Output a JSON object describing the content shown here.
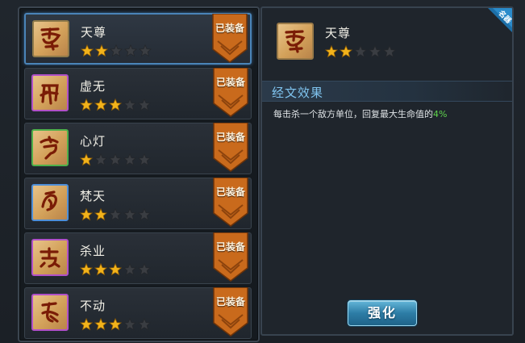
{
  "colors": {
    "star_gold": "#f2b31b",
    "star_empty": "#3a3d42",
    "badge_orange": "#c96a1c",
    "accent_blue": "#4a84b8",
    "highlight_green": "#5fd44d"
  },
  "list": {
    "items": [
      {
        "name": "天尊",
        "stars_filled": 2,
        "stars_total": 5,
        "badge": "已装备",
        "frame_color": "#8f7a4a",
        "icon": "rune-glyph-icon",
        "selected": true
      },
      {
        "name": "虚无",
        "stars_filled": 3,
        "stars_total": 5,
        "badge": "已装备",
        "frame_color": "#b050c8",
        "icon": "rune-glyph-icon",
        "selected": false
      },
      {
        "name": "心灯",
        "stars_filled": 1,
        "stars_total": 5,
        "badge": "已装备",
        "frame_color": "#4fb04a",
        "icon": "rune-glyph-icon",
        "selected": false
      },
      {
        "name": "梵天",
        "stars_filled": 2,
        "stars_total": 5,
        "badge": "已装备",
        "frame_color": "#4d8ed8",
        "icon": "rune-glyph-icon",
        "selected": false
      },
      {
        "name": "杀业",
        "stars_filled": 3,
        "stars_total": 5,
        "badge": "已装备",
        "frame_color": "#b050c8",
        "icon": "rune-glyph-icon",
        "selected": false
      },
      {
        "name": "不动",
        "stars_filled": 3,
        "stars_total": 5,
        "badge": "已装备",
        "frame_color": "#b050c8",
        "icon": "rune-glyph-icon",
        "selected": false
      }
    ]
  },
  "detail": {
    "name": "天尊",
    "stars_filled": 2,
    "stars_total": 5,
    "corner_tag": "名器",
    "section_title": "经文效果",
    "effect_prefix": "每击杀一个敌方单位，回复最大生命值的",
    "effect_value": "4%",
    "enhance_label": "强化"
  }
}
